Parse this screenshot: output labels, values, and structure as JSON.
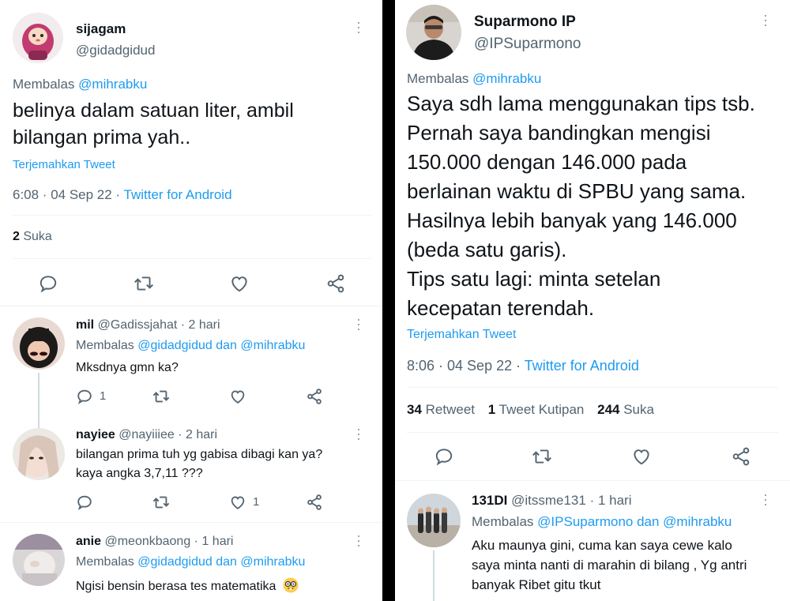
{
  "left": {
    "main_tweet": {
      "name": "sijagam",
      "handle": "@gidadgidud",
      "reply_prefix": "Membalas",
      "reply_to": "@mihrabku",
      "text_line1": "belinya dalam satuan liter, ambil",
      "text_line2": "bilangan prima yah..",
      "translate": "Terjemahkan Tweet",
      "time": "6:08 · 04 Sep 22 · ",
      "client": "Twitter for Android",
      "likes_count": "2",
      "likes_label": " Suka"
    },
    "replies": [
      {
        "name": "mil",
        "handle": "@Gadissjahat · 2 hari",
        "reply_prefix": "Membalas",
        "reply_to": "@gidadgidud dan @mihrabku",
        "text": "Mksdnya gmn ka?",
        "reply_count": "1",
        "like_count": ""
      },
      {
        "name": "nayiee",
        "handle": "@nayiiiee · 2 hari",
        "text_line1": "bilangan prima tuh yg gabisa dibagi kan ya?",
        "text_line2": "kaya angka 3,7,11 ???",
        "reply_count": "",
        "like_count": "1"
      },
      {
        "name": "anie",
        "handle": "@meonkbaong · 1 hari",
        "reply_prefix": "Membalas",
        "reply_to": "@gidadgidud dan @mihrabku",
        "text": "Ngisi bensin berasa tes matematika"
      }
    ]
  },
  "right": {
    "main_tweet": {
      "name": "Suparmono IP",
      "handle": "@IPSuparmono",
      "reply_prefix": "Membalas",
      "reply_to": "@mihrabku",
      "lines": [
        "Saya sdh lama menggunakan tips tsb.",
        "Pernah saya bandingkan mengisi",
        "150.000 dengan 146.000 pada",
        "berlainan waktu di SPBU yang sama.",
        "Hasilnya lebih banyak yang 146.000",
        "(beda satu garis).",
        "Tips satu lagi: minta setelan",
        "kecepatan terendah."
      ],
      "translate": "Terjemahkan Tweet",
      "time": "8:06 · 04 Sep 22 · ",
      "client": "Twitter for Android",
      "retweet_count": "34",
      "retweet_label": " Retweet",
      "quote_count": "1",
      "quote_label": " Tweet Kutipan",
      "likes_count": "244",
      "likes_label": " Suka"
    },
    "reply": {
      "name": "131DI",
      "handle": "@itssme131 · 1 hari",
      "reply_prefix": "Membalas",
      "reply_to": "@IPSuparmono dan @mihrabku",
      "text_line1": "Aku maunya gini, cuma kan saya cewe kalo",
      "text_line2": "saya minta nanti di marahin di bilang , Yg antri",
      "text_line3": "banyak Ribet gitu tkut"
    }
  },
  "colors": {
    "link": "#1d9bf0",
    "muted": "#536471",
    "text": "#0f1419",
    "divider": "#000000"
  },
  "icons": [
    "reply-icon",
    "retweet-icon",
    "like-icon",
    "share-icon",
    "more-icon",
    "nerd-face-emoji"
  ]
}
